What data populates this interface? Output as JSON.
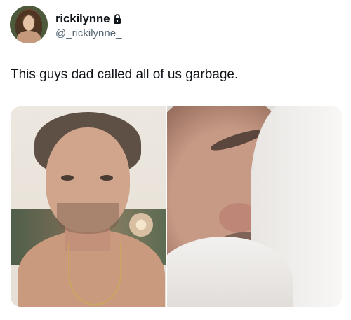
{
  "tweet": {
    "display_name": "rickilynne",
    "handle": "@_rickilynne_",
    "protected_icon": "lock-icon",
    "text": "This guys dad called all of us garbage."
  },
  "media": {
    "count": 2
  }
}
